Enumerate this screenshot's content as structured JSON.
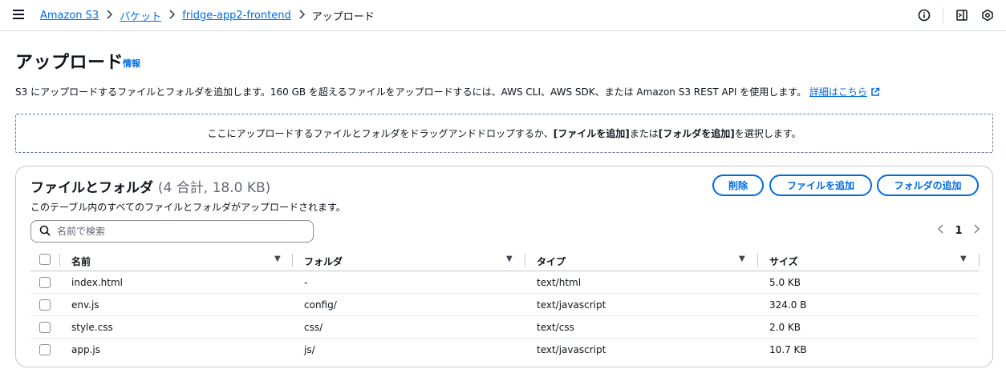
{
  "breadcrumb": {
    "items": [
      "Amazon S3",
      "バケット",
      "fridge-app2-frontend"
    ],
    "current": "アップロード"
  },
  "page": {
    "title": "アップロード",
    "info_link": "情報",
    "description": "S3 にアップロードするファイルとフォルダを追加します。160 GB を超えるファイルをアップロードするには、AWS CLI、AWS SDK、または Amazon S3 REST API を使用します。",
    "learn_more": "詳細はこちら"
  },
  "dropzone": {
    "text_before": "ここにアップロードするファイルとフォルダをドラッグアンドドロップするか、",
    "add_files": "[ファイルを追加]",
    "text_mid": " または ",
    "add_folder": "[フォルダを追加]",
    "text_after": " を選択します。"
  },
  "panel": {
    "title": "ファイルとフォルダ",
    "count": "(4 合計, 18.0 KB)",
    "subtitle": "このテーブル内のすべてのファイルとフォルダがアップロードされます。",
    "delete_button": "削除",
    "add_files_button": "ファイルを追加",
    "add_folder_button": "フォルダの追加",
    "search_placeholder": "名前で検索",
    "current_page": "1"
  },
  "table": {
    "columns": [
      "名前",
      "フォルダ",
      "タイプ",
      "サイズ"
    ],
    "rows": [
      {
        "name": "index.html",
        "folder": "-",
        "type": "text/html",
        "size": "5.0 KB"
      },
      {
        "name": "env.js",
        "folder": "config/",
        "type": "text/javascript",
        "size": "324.0 B"
      },
      {
        "name": "style.css",
        "folder": "css/",
        "type": "text/css",
        "size": "2.0 KB"
      },
      {
        "name": "app.js",
        "folder": "js/",
        "type": "text/javascript",
        "size": "10.7 KB"
      }
    ]
  },
  "icons": {
    "menu": "hamburger-icon",
    "info": "info-circle-icon",
    "panel": "side-panel-icon",
    "settings": "hexagon-settings-icon",
    "search": "search-icon",
    "external": "external-link-icon"
  },
  "colors": {
    "link": "#006ce0",
    "text": "#0f141a",
    "border": "#c6c6cd"
  }
}
